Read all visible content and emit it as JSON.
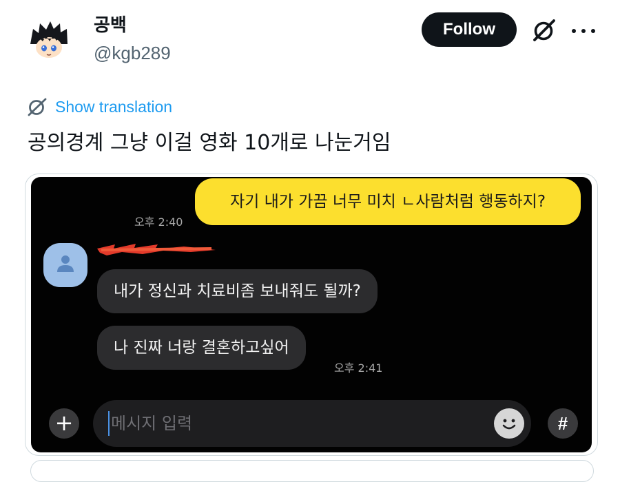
{
  "author": {
    "display_name": "공백",
    "handle": "@kgb289",
    "avatar_icon": "anime-character-avatar"
  },
  "actions": {
    "follow_label": "Follow",
    "grok_icon": "grok-icon",
    "more_icon": "more-dots-icon"
  },
  "translation": {
    "label": "Show translation",
    "icon": "translate-globe-icon"
  },
  "tweet": {
    "text": "공의경계 그냥 이걸 영화 10개로 나눈거임"
  },
  "chat": {
    "outgoing": {
      "text": "자기 내가 가끔 너무 미치 ㄴ사람처럼 행동하지?",
      "time": "오후 2:40"
    },
    "incoming": [
      {
        "text": "내가 정신과 치료비좀 보내줘도 될까?"
      },
      {
        "text": "나 진짜 너랑 결혼하고싶어"
      }
    ],
    "incoming_time": "오후 2:41",
    "input_placeholder": "메시지 입력",
    "plus_label": "+",
    "hash_label": "#"
  },
  "colors": {
    "follow_bg": "#0f1419",
    "link_blue": "#1d9bf0",
    "kakao_yellow": "#fcdf2e",
    "redaction_red": "#e23a2a"
  }
}
